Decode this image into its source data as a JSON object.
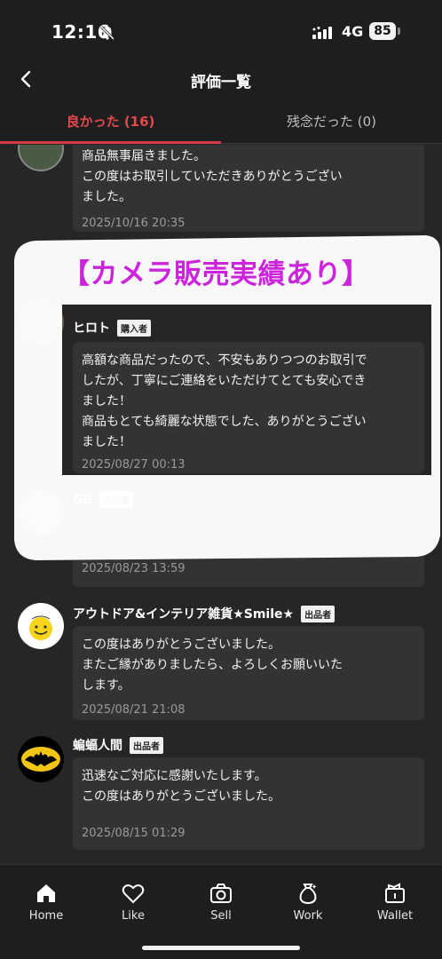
{
  "status_bar": {
    "time": "12:16",
    "network": "4G",
    "battery": "85"
  },
  "header": {
    "title": "評価一覧"
  },
  "tabs": [
    {
      "label": "良かった (16)"
    },
    {
      "label": "残念だった (0)"
    }
  ],
  "reviews": [
    {
      "name": "",
      "badge": "",
      "text": "商品無事届きました。\nこの度はお取引していただきありがとうござい\nました。",
      "date": "2025/10/16 20:35"
    },
    {
      "name": "ヒロト",
      "badge": "購入者",
      "text": "高額な商品だったので、不安もありつつのお取引で\nしたが、丁寧にご連絡をいただけてとても安心でき\nました！\n商品もとても綺麗な状態でした、ありがとうござい\nました！",
      "date": "2025/08/27 00:13"
    },
    {
      "name": "GB",
      "badge": "出品者",
      "text": "",
      "date": "2025/08/23 13:59"
    },
    {
      "name": "アウトドア&インテリア雑貨★Smile★",
      "badge": "出品者",
      "text": "この度はありがとうございました。\nまたご縁がありましたら、よろしくお願いいた\nします。",
      "date": "2025/08/21 21:08"
    },
    {
      "name": "蝙蝠人間",
      "badge": "出品者",
      "text": "迅速なご対応に感謝いたします。\nこの度はありがとうございました。",
      "date": "2025/08/15 01:29"
    }
  ],
  "overlay": {
    "promo_text": "【カメラ販売実績あり】"
  },
  "bottom_nav": [
    {
      "label": "Home",
      "icon": "home-icon"
    },
    {
      "label": "Like",
      "icon": "heart-icon"
    },
    {
      "label": "Sell",
      "icon": "camera-icon"
    },
    {
      "label": "Work",
      "icon": "moneybag-icon"
    },
    {
      "label": "Wallet",
      "icon": "wallet-icon"
    }
  ],
  "colors": {
    "accent": "#d33b45",
    "promo": "#cc23dd",
    "background": "#262626"
  }
}
